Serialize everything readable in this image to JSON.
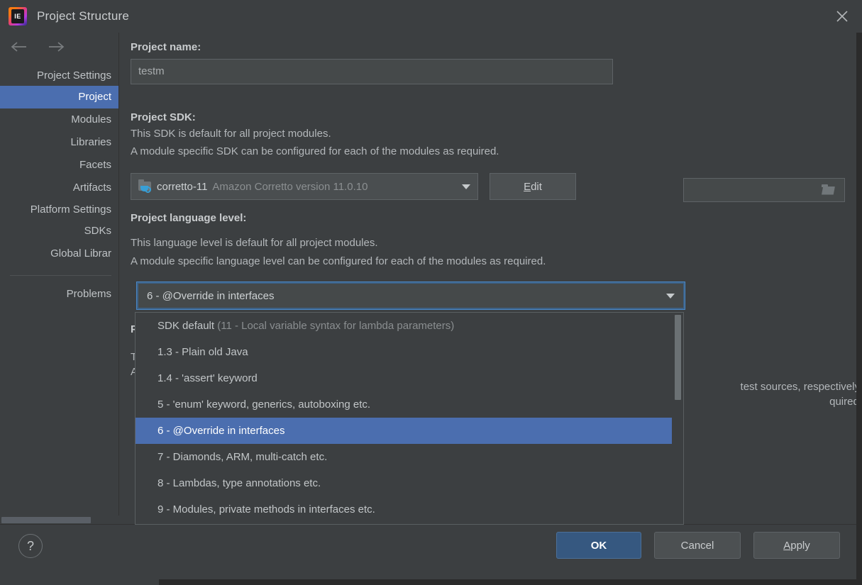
{
  "window": {
    "title": "Project Structure",
    "logo_text": "IE",
    "close_icon": "close-icon"
  },
  "sidebar": {
    "back_icon": "arrow-left-icon",
    "forward_icon": "arrow-right-icon",
    "groups": [
      {
        "label": "Project Settings",
        "items": [
          {
            "label": "Project",
            "selected": true
          },
          {
            "label": "Modules",
            "selected": false
          },
          {
            "label": "Libraries",
            "selected": false
          },
          {
            "label": "Facets",
            "selected": false
          },
          {
            "label": "Artifacts",
            "selected": false
          }
        ]
      },
      {
        "label": "Platform Settings",
        "items": [
          {
            "label": "SDKs",
            "selected": false
          },
          {
            "label": "Global Librar",
            "selected": false
          }
        ]
      }
    ],
    "problems_label": "Problems"
  },
  "main": {
    "project_name_label": "Project name:",
    "project_name_value": "testm",
    "sdk_label": "Project SDK:",
    "sdk_desc_1": "This SDK is default for all project modules.",
    "sdk_desc_2": "A module specific SDK can be configured for each of the modules as required.",
    "sdk_selected_name": "corretto-11",
    "sdk_selected_desc": "Amazon Corretto version 11.0.10",
    "sdk_icon": "java-sdk-folder-icon",
    "edit_button": "Edit",
    "edit_button_mnemonic": "E",
    "edit_button_rest": "dit",
    "lang_label": "Project language level:",
    "lang_desc_1": "This language level is default for all project modules.",
    "lang_desc_2": "A module specific language level can be configured for each of the modules as required.",
    "lang_selected": "6 - @Override in interfaces",
    "compiler_label": "P",
    "compiler_line_1": "T",
    "compiler_line_2": "A",
    "compiler_line_3_tail": " test sources, respectively.",
    "compiler_line_4_tail": "quired.",
    "compiler_field_value": "",
    "browse_icon": "folder-browse-icon"
  },
  "lang_dropdown": {
    "options": [
      {
        "label": "SDK default",
        "note": " (11 - Local variable syntax for lambda parameters)",
        "selected": false
      },
      {
        "label": "1.3 - Plain old Java",
        "note": "",
        "selected": false
      },
      {
        "label": "1.4 - 'assert' keyword",
        "note": "",
        "selected": false
      },
      {
        "label": "5 - 'enum' keyword, generics, autoboxing etc.",
        "note": "",
        "selected": false
      },
      {
        "label": "6 - @Override in interfaces",
        "note": "",
        "selected": true
      },
      {
        "label": "7 - Diamonds, ARM, multi-catch etc.",
        "note": "",
        "selected": false
      },
      {
        "label": "8 - Lambdas, type annotations etc.",
        "note": "",
        "selected": false
      },
      {
        "label": "9 - Modules, private methods in interfaces etc.",
        "note": "",
        "selected": false
      }
    ]
  },
  "footer": {
    "help_label": "?",
    "ok_label": "OK",
    "cancel_label": "Cancel",
    "apply_mnemonic": "A",
    "apply_rest": "pply"
  },
  "colors": {
    "window_bg": "#3c3f41",
    "accent_selection": "#4b6eaf",
    "ok_button": "#365880",
    "focus_border": "#4a88c7",
    "text_primary": "#bbbbbb",
    "text_muted": "#8b8f91"
  }
}
